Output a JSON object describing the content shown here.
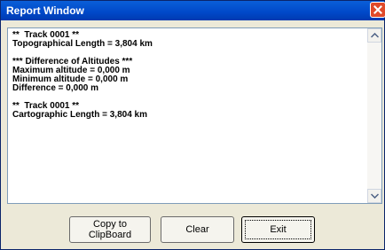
{
  "window": {
    "title": "Report Window"
  },
  "report": {
    "lines": [
      "**  Track 0001 **",
      "Topographical Length = 3,804 km",
      "",
      "*** Difference of Altitudes ***",
      "Maximum altitude = 0,000 m",
      "Minimum altitude = 0,000 m",
      "Difference = 0,000 m",
      "",
      "**  Track 0001 **",
      "Cartographic Length = 3,804 km"
    ]
  },
  "buttons": {
    "copy_label": "Copy to ClipBoard",
    "clear_label": "Clear",
    "exit_label": "Exit"
  },
  "colors": {
    "title_bar": "#0055e5",
    "close_button": "#e04a2a",
    "dialog_face": "#ece9d8"
  }
}
